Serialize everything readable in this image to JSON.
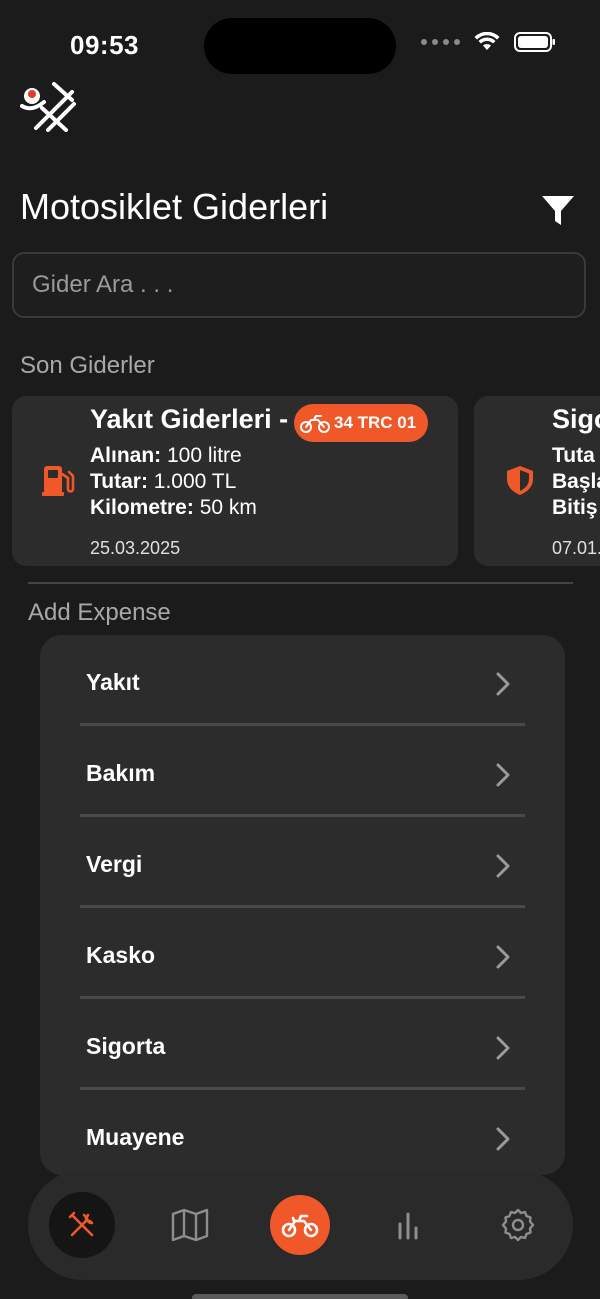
{
  "status_bar": {
    "time": "09:53"
  },
  "header": {
    "title": "Motosiklet Giderleri",
    "filter_icon": "filter-icon"
  },
  "search": {
    "placeholder": "Gider Ara . . .",
    "value": ""
  },
  "recent": {
    "label": "Son Giderler",
    "cards": [
      {
        "icon": "fuel-pump-icon",
        "title": "Yakıt Giderleri -",
        "plate": "34 TRC 01",
        "line1_label": "Alınan:",
        "line1_value": " 100 litre",
        "line2_label": "Tutar:",
        "line2_value": " 1.000 TL",
        "line3_label": "Kilometre:",
        "line3_value": " 50 km",
        "date": "25.03.2025"
      },
      {
        "icon": "shield-icon",
        "title": "Sigo",
        "line1_label": "Tuta",
        "line2_label": "Başla",
        "line3_label": "Bitiş",
        "date": "07.01."
      }
    ]
  },
  "add_expense": {
    "label": "Add Expense",
    "items": [
      {
        "label": "Yakıt"
      },
      {
        "label": "Bakım"
      },
      {
        "label": "Vergi"
      },
      {
        "label": "Kasko"
      },
      {
        "label": "Sigorta"
      },
      {
        "label": "Muayene"
      }
    ]
  },
  "tab_bar": {
    "tabs": [
      {
        "icon": "tools-icon",
        "active": true
      },
      {
        "icon": "map-icon",
        "active": false
      },
      {
        "icon": "motorcycle-icon",
        "active": true
      },
      {
        "icon": "bar-chart-icon",
        "active": false
      },
      {
        "icon": "settings-gear-icon",
        "active": false
      }
    ]
  },
  "colors": {
    "background": "#1b1b1b",
    "card": "#2c2c2c",
    "accent": "#f0582a",
    "muted_text": "#a8a8a8"
  }
}
